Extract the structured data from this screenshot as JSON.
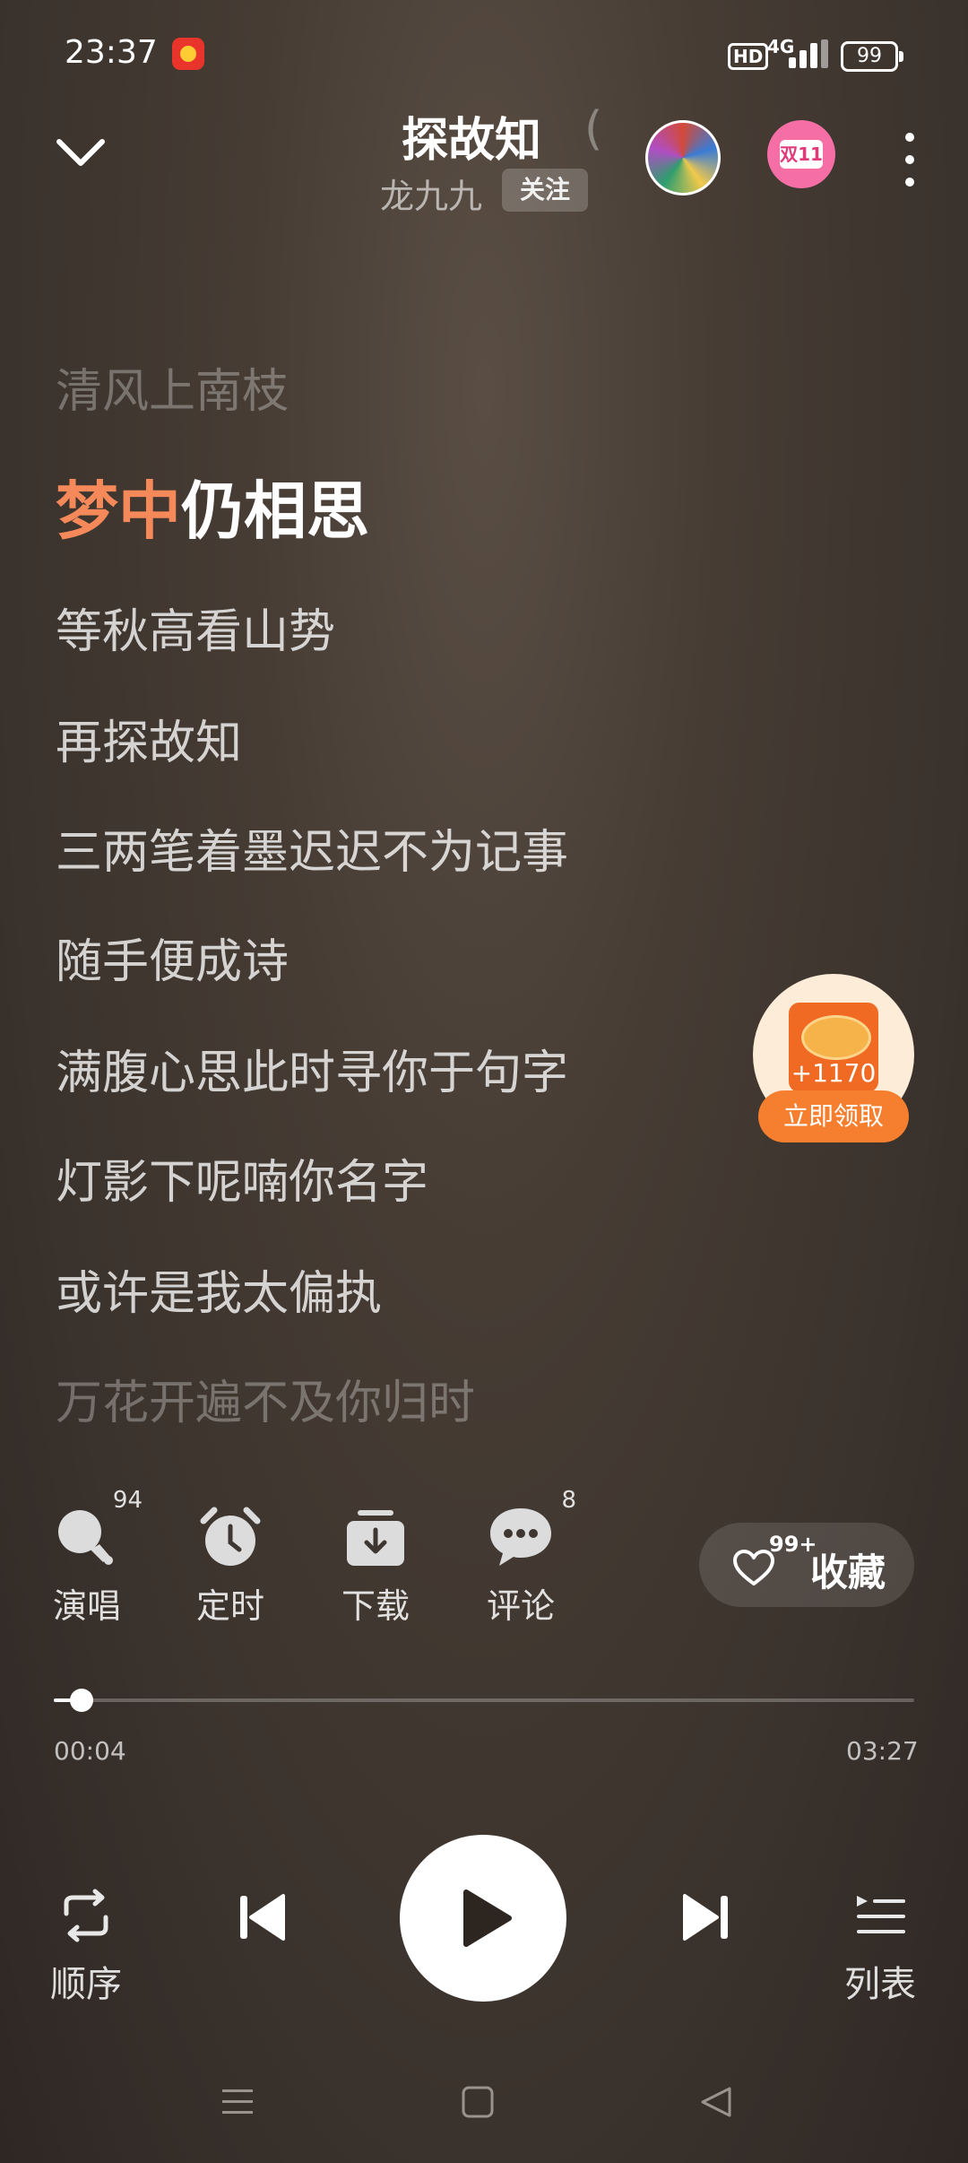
{
  "status_bar": {
    "time": "23:37",
    "network_badge": "HD",
    "network_type": "4G",
    "battery": "99"
  },
  "header": {
    "title": "探故知",
    "title_overflow": "(",
    "artist": "龙九九",
    "follow_label": "关注",
    "promo_badge": "双11"
  },
  "lyrics": {
    "previous": "清风上南枝",
    "current_sung": "梦中",
    "current_rest": "仍相思",
    "upcoming": [
      "等秋高看山势",
      "再探故知",
      "三两笔着墨迟迟不为记事",
      "随手便成诗",
      "满腹心思此时寻你于句字",
      "灯影下呢喃你名字",
      "或许是我太偏执"
    ],
    "next_faded": "万花开遍不及你归时"
  },
  "reward": {
    "amount": "+1170",
    "button_label": "立即领取"
  },
  "actions": {
    "sing": {
      "label": "演唱",
      "count": "94"
    },
    "timer": {
      "label": "定时"
    },
    "download": {
      "label": "下载"
    },
    "comment": {
      "label": "评论",
      "count": "8"
    },
    "favorite": {
      "label": "收藏",
      "count": "99+"
    }
  },
  "progress": {
    "current": "00:04",
    "total": "03:27",
    "fraction": 0.032
  },
  "controls": {
    "order_label": "顺序",
    "list_label": "列表"
  },
  "colors": {
    "accent": "#f5895a",
    "reward_orange": "#f57f2f"
  }
}
